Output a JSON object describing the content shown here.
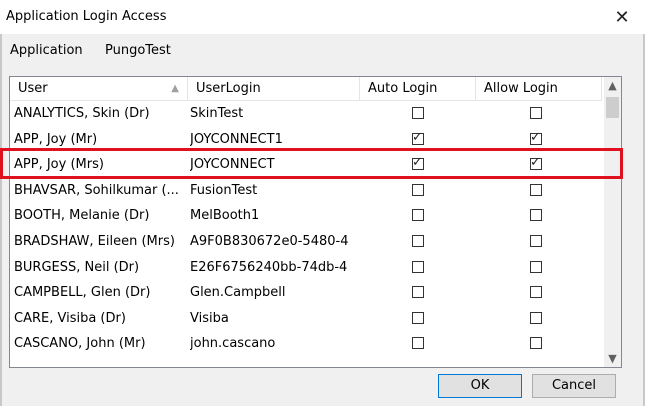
{
  "window": {
    "title": "Application Login Access",
    "close_glyph": "✕"
  },
  "application": {
    "label": "Application",
    "value": "PungoTest"
  },
  "table": {
    "columns": [
      "User",
      "UserLogin",
      "Auto Login",
      "Allow Login"
    ],
    "sort_column": "User",
    "sort_direction": "ascending",
    "rows": [
      {
        "user": "ANALYTICS, Skin (Dr)",
        "login": "SkinTest",
        "auto": false,
        "allow": false
      },
      {
        "user": "APP, Joy (Mr)",
        "login": "JOYCONNECT1",
        "auto": true,
        "allow": true
      },
      {
        "user": "APP, Joy (Mrs)",
        "login": "JOYCONNECT",
        "auto": true,
        "allow": true,
        "highlighted": true
      },
      {
        "user": "BHAVSAR, Sohilkumar (...",
        "login": "FusionTest",
        "auto": false,
        "allow": false
      },
      {
        "user": "BOOTH, Melanie (Dr)",
        "login": "MelBooth1",
        "auto": false,
        "allow": false
      },
      {
        "user": "BRADSHAW, Eileen (Mrs)",
        "login": "A9F0B830672e0-5480-4",
        "auto": false,
        "allow": false
      },
      {
        "user": "BURGESS, Neil (Dr)",
        "login": "E26F6756240bb-74db-4",
        "auto": false,
        "allow": false
      },
      {
        "user": "CAMPBELL, Glen (Dr)",
        "login": "Glen.Campbell",
        "auto": false,
        "allow": false
      },
      {
        "user": "CARE, Visiba (Dr)",
        "login": "Visiba",
        "auto": false,
        "allow": false
      },
      {
        "user": "CASCANO, John (Mr)",
        "login": "john.cascano",
        "auto": false,
        "allow": false
      }
    ]
  },
  "buttons": {
    "ok": "OK",
    "cancel": "Cancel"
  },
  "colors": {
    "highlight_border": "#e0101e",
    "grid_border": "#828790"
  }
}
